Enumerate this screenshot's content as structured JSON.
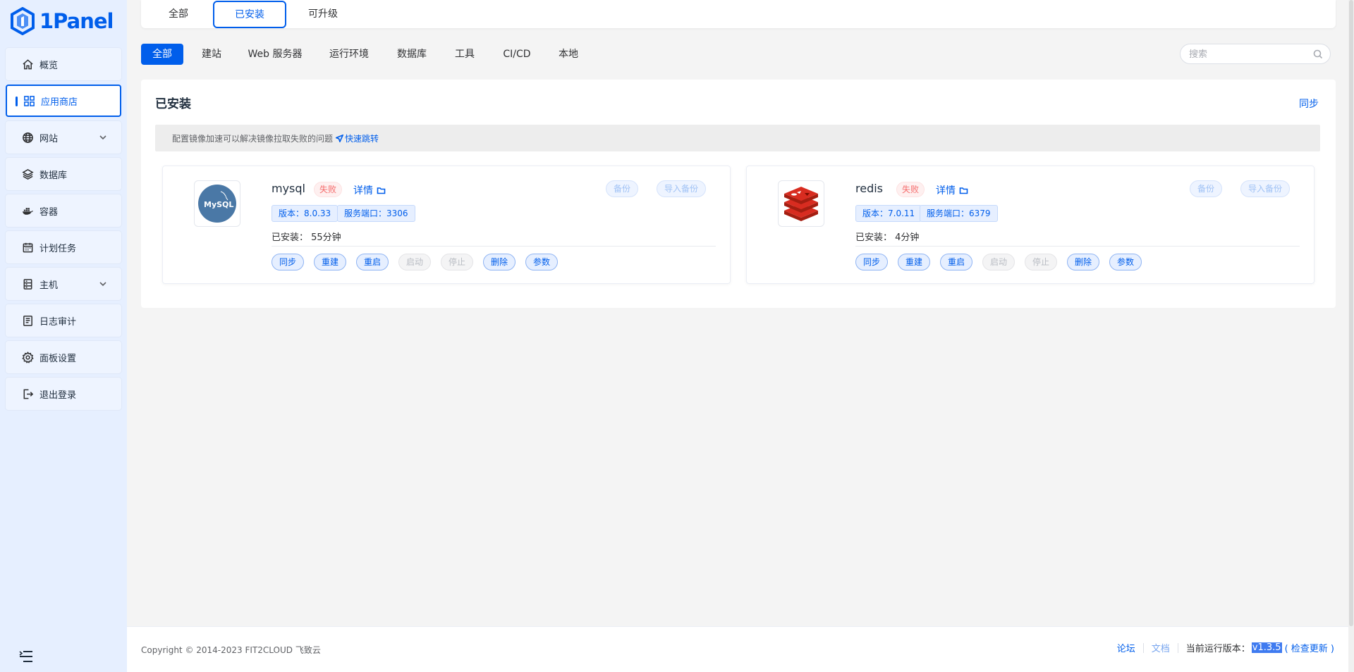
{
  "brand": {
    "name": "1Panel",
    "color": "#005eeb"
  },
  "sidebar": {
    "items": [
      {
        "label": "概览",
        "icon": "home-icon"
      },
      {
        "label": "应用商店",
        "icon": "grid-icon",
        "active": true
      },
      {
        "label": "网站",
        "icon": "globe-icon",
        "expandable": true
      },
      {
        "label": "数据库",
        "icon": "layers-icon"
      },
      {
        "label": "容器",
        "icon": "docker-icon"
      },
      {
        "label": "计划任务",
        "icon": "calendar-icon"
      },
      {
        "label": "主机",
        "icon": "server-icon",
        "expandable": true
      },
      {
        "label": "日志审计",
        "icon": "log-icon"
      },
      {
        "label": "面板设置",
        "icon": "gear-icon"
      },
      {
        "label": "退出登录",
        "icon": "logout-icon"
      }
    ]
  },
  "top_tabs": {
    "all": "全部",
    "installed": "已安装",
    "upgradable": "可升级",
    "active": "已安装"
  },
  "categories": {
    "items": [
      "全部",
      "建站",
      "Web 服务器",
      "运行环境",
      "数据库",
      "工具",
      "CI/CD",
      "本地"
    ],
    "active": "全部"
  },
  "search": {
    "placeholder": "搜索",
    "value": ""
  },
  "installed": {
    "title": "已安装",
    "sync_label": "同步",
    "notice_text": "配置镜像加速可以解决镜像拉取失败的问题",
    "notice_link": "快速跳转",
    "apps": [
      {
        "name": "mysql",
        "status": "失败",
        "detail_label": "详情",
        "backup_label": "备份",
        "import_backup_label": "导入备份",
        "version_tag": "版本：8.0.33",
        "port_tag": "服务端口：3306",
        "installed_time": "已安装： 55分钟",
        "ops": [
          {
            "label": "同步",
            "enabled": true
          },
          {
            "label": "重建",
            "enabled": true
          },
          {
            "label": "重启",
            "enabled": true
          },
          {
            "label": "启动",
            "enabled": false
          },
          {
            "label": "停止",
            "enabled": false
          },
          {
            "label": "删除",
            "enabled": true
          },
          {
            "label": "参数",
            "enabled": true
          }
        ],
        "icon": "mysql-logo-icon",
        "logo_text": "MySQL"
      },
      {
        "name": "redis",
        "status": "失败",
        "detail_label": "详情",
        "backup_label": "备份",
        "import_backup_label": "导入备份",
        "version_tag": "版本：7.0.11",
        "port_tag": "服务端口：6379",
        "installed_time": "已安装： 4分钟",
        "ops": [
          {
            "label": "同步",
            "enabled": true
          },
          {
            "label": "重建",
            "enabled": true
          },
          {
            "label": "重启",
            "enabled": true
          },
          {
            "label": "启动",
            "enabled": false
          },
          {
            "label": "停止",
            "enabled": false
          },
          {
            "label": "删除",
            "enabled": true
          },
          {
            "label": "参数",
            "enabled": true
          }
        ],
        "icon": "redis-logo-icon"
      }
    ]
  },
  "footer": {
    "copyright": "Copyright © 2014-2023 FIT2CLOUD 飞致云",
    "forum": "论坛",
    "docs": "文档",
    "version_label": "当前运行版本：",
    "version": "v1.3.5",
    "check_update": "( 检查更新 )"
  }
}
